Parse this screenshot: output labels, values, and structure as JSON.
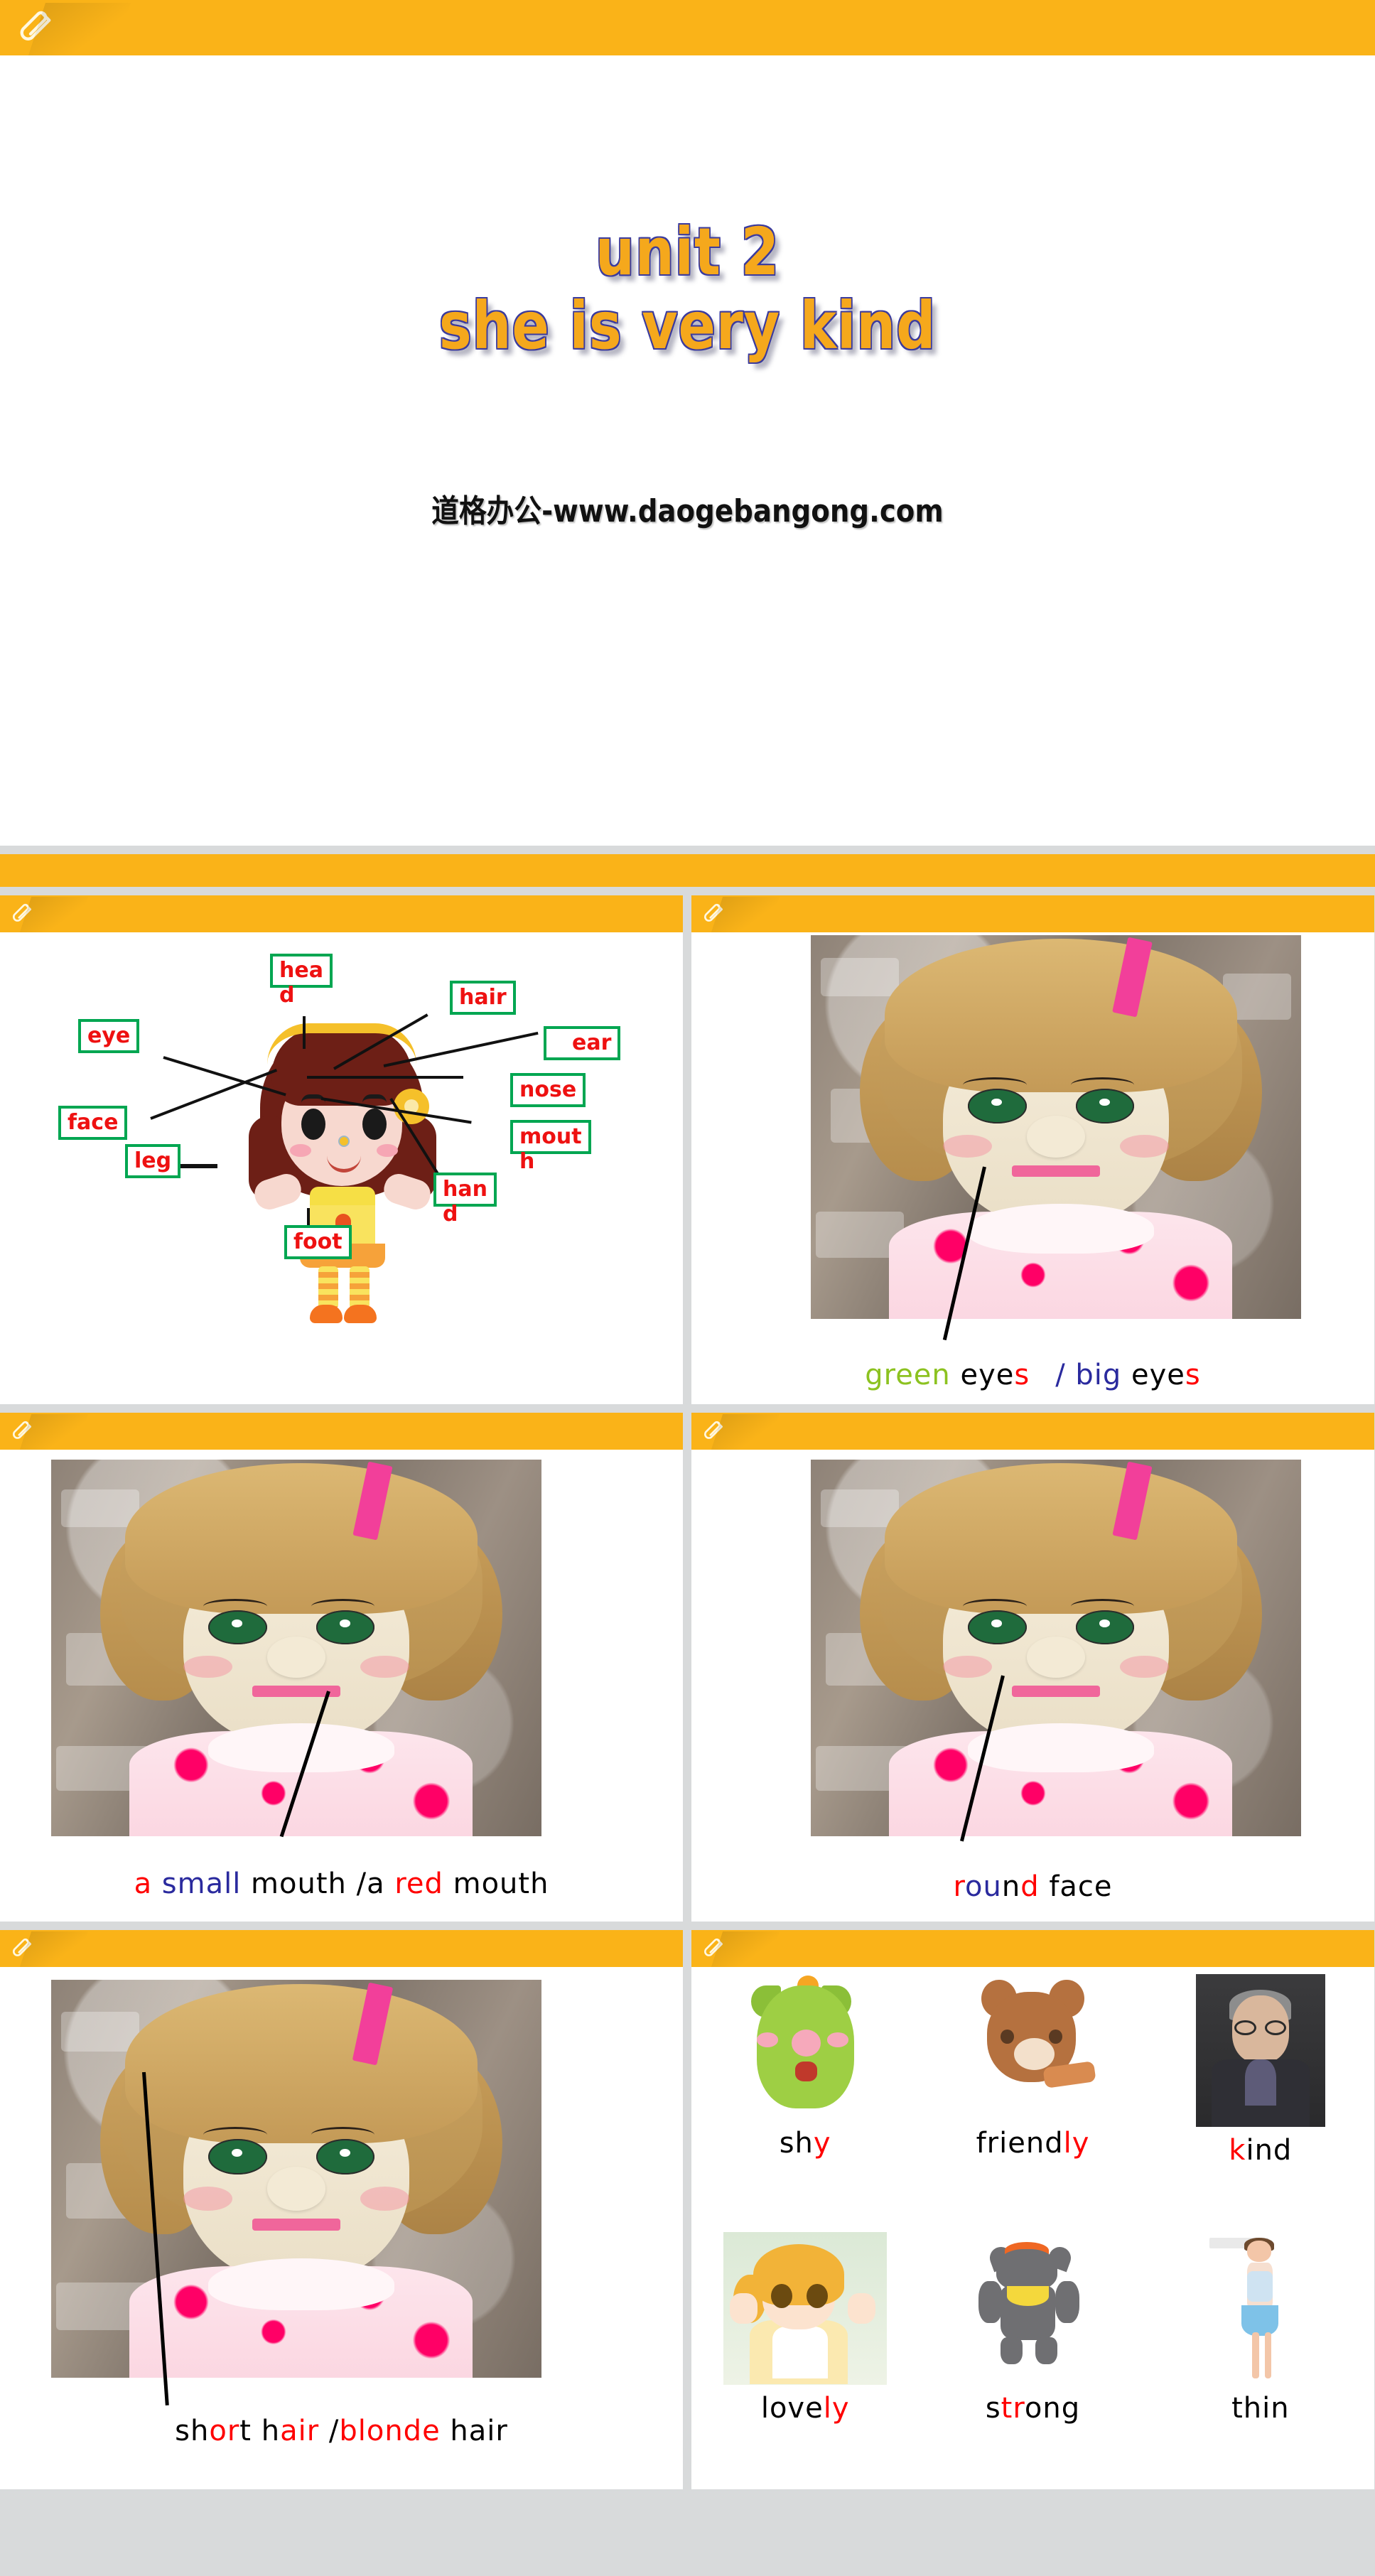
{
  "document": {
    "kind": "presentation-slides",
    "accent_color": "#fab318",
    "page_background": "#d8dadb"
  },
  "icons": {
    "paperclip": "paperclip-icon"
  },
  "slide_title": {
    "line1": "unit 2",
    "line2": "she is very kind",
    "watermark": "道格办公-www.daogebangong.com"
  },
  "body_parts": {
    "labels": [
      {
        "id": "head",
        "text": "hea",
        "overflow": "d"
      },
      {
        "id": "hair",
        "text": "hair",
        "overflow": ""
      },
      {
        "id": "ear",
        "text": "ear",
        "overflow": ""
      },
      {
        "id": "nose",
        "text": "nose",
        "overflow": ""
      },
      {
        "id": "mouth",
        "text": "mout",
        "overflow": "h"
      },
      {
        "id": "hand",
        "text": "han",
        "overflow": "d"
      },
      {
        "id": "eye",
        "text": "eye",
        "overflow": ""
      },
      {
        "id": "face",
        "text": "face",
        "overflow": ""
      },
      {
        "id": "leg",
        "text": "leg",
        "overflow": ""
      },
      {
        "id": "foot",
        "text": "foot",
        "overflow": ""
      }
    ],
    "label_text_color": "#ee1111",
    "label_border_color": "#00a651"
  },
  "captions": {
    "eyes": {
      "full_text": "green eyes  / big eyes",
      "segments": [
        {
          "text": "green",
          "color": "#8cc220"
        },
        {
          "text": " eye",
          "color": "#000000"
        },
        {
          "text": "s",
          "color": "#ff0000"
        },
        {
          "text": "/ big",
          "color": "#2a2a9e"
        },
        {
          "text": " eye",
          "color": "#000000"
        },
        {
          "text": "s",
          "color": "#ff0000"
        }
      ]
    },
    "mouth": {
      "full_text": "a small mouth  /a red mouth",
      "segments": [
        {
          "text": "a",
          "color": "#ff0000"
        },
        {
          "text": " small",
          "color": "#2a2a9e"
        },
        {
          "text": " mouth",
          "color": "#000000"
        },
        {
          "text": "  /a ",
          "color": "#000000"
        },
        {
          "text": "red",
          "color": "#ff0000"
        },
        {
          "text": " mouth",
          "color": "#000000"
        }
      ]
    },
    "face": {
      "full_text": "round face",
      "segments": [
        {
          "text": "r",
          "color": "#ff0000"
        },
        {
          "text": "ou",
          "color": "#2a2a9e"
        },
        {
          "text": "n",
          "color": "#000000"
        },
        {
          "text": "d",
          "color": "#ff0000"
        },
        {
          "text": " face",
          "color": "#000000"
        }
      ]
    },
    "hair": {
      "full_text": "short hair  /blonde hair",
      "segments": [
        {
          "text": "sh",
          "color": "#000000"
        },
        {
          "text": "or",
          "color": "#ff0000"
        },
        {
          "text": "t",
          "color": "#000000"
        },
        {
          "text": " h",
          "color": "#000000"
        },
        {
          "text": "air",
          "color": "#ff0000"
        },
        {
          "text": "  /",
          "color": "#000000"
        },
        {
          "text": "blonde",
          "color": "#ff0000"
        },
        {
          "text": " hair",
          "color": "#000000"
        }
      ]
    }
  },
  "traits": {
    "row1": [
      {
        "id": "shy",
        "image": "green-pig-illustration",
        "segments": [
          {
            "text": "sh",
            "color": "#000000"
          },
          {
            "text": "y",
            "color": "#ff0000"
          }
        ]
      },
      {
        "id": "friendly",
        "image": "brown-bear-illustration",
        "segments": [
          {
            "text": "friend",
            "color": "#000000"
          },
          {
            "text": "ly",
            "color": "#ff0000"
          }
        ]
      },
      {
        "id": "kind",
        "image": "man-with-glasses-photo",
        "segments": [
          {
            "text": "k",
            "color": "#ff0000"
          },
          {
            "text": "ind",
            "color": "#000000"
          }
        ]
      }
    ],
    "row2": [
      {
        "id": "lovely",
        "image": "anime-child-illustration",
        "segments": [
          {
            "text": "love",
            "color": "#000000"
          },
          {
            "text": "ly",
            "color": "#ff0000"
          }
        ]
      },
      {
        "id": "strong",
        "image": "grey-wolf-illustration",
        "segments": [
          {
            "text": "s",
            "color": "#000000"
          },
          {
            "text": "tr",
            "color": "#ff0000"
          },
          {
            "text": "ong",
            "color": "#000000"
          }
        ]
      },
      {
        "id": "thin",
        "image": "thin-woman-illustration",
        "segments": [
          {
            "text": "thin",
            "color": "#000000"
          }
        ]
      }
    ]
  },
  "photos": {
    "doll_eyes": "doll-face-photo-eyes",
    "doll_mouth": "doll-face-photo-mouth",
    "doll_face": "doll-face-photo-face",
    "doll_hair": "doll-face-photo-hair"
  }
}
